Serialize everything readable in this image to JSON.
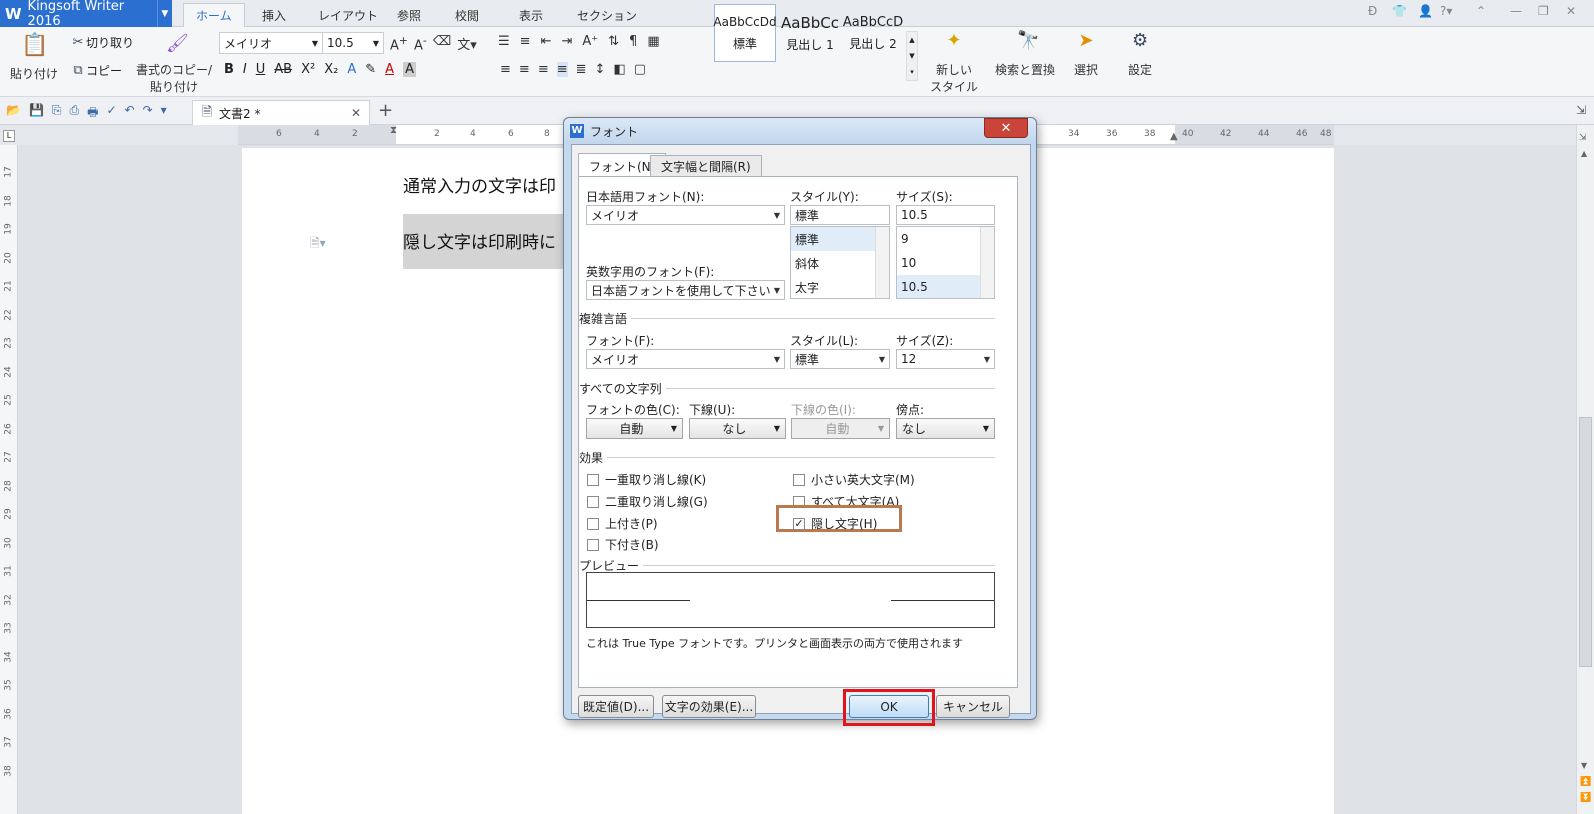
{
  "app": {
    "title": "Kingsoft Writer 2016"
  },
  "ribbon_tabs": [
    "ホーム",
    "挿入",
    "レイアウト",
    "参照",
    "校閲",
    "表示",
    "セクション"
  ],
  "ribbon": {
    "paste": "貼り付け",
    "cut": "切り取り",
    "copy": "コピー",
    "format_painter_1": "書式のコピー/",
    "format_painter_2": "貼り付け",
    "font_name": "メイリオ",
    "font_size": "10.5",
    "styles": [
      {
        "preview": "AaBbCcDd",
        "label": "標準"
      },
      {
        "preview": "AaBbCc",
        "label": "見出し 1"
      },
      {
        "preview": "AaBbCcD",
        "label": "見出し 2"
      }
    ],
    "new_style_1": "新しい",
    "new_style_2": "スタイル",
    "find_replace": "検索と置換",
    "select": "選択",
    "settings": "設定"
  },
  "doc_tab": {
    "name": "文書2 *"
  },
  "ruler": {
    "h_ticks": [
      "6",
      "4",
      "2",
      "2",
      "4",
      "6",
      "8",
      "34",
      "36",
      "38",
      "40",
      "42",
      "44",
      "46",
      "48"
    ],
    "v_ticks": [
      "17",
      "18",
      "19",
      "20",
      "21",
      "22",
      "23",
      "24",
      "25",
      "26",
      "27",
      "28",
      "29",
      "30",
      "31",
      "32",
      "33",
      "34",
      "35",
      "36",
      "37",
      "38"
    ]
  },
  "document": {
    "line1": "通常入力の文字は印",
    "line2": "隠し文字は印刷時に"
  },
  "dialog": {
    "title": "フォント",
    "tabs": [
      "フォント(N)",
      "文字幅と間隔(R)"
    ],
    "jp_font_label": "日本語用フォント(N):",
    "jp_font_value": "メイリオ",
    "style_label": "スタイル(Y):",
    "style_value": "標準",
    "style_list": [
      "標準",
      "斜体",
      "太字"
    ],
    "size_label": "サイズ(S):",
    "size_value": "10.5",
    "size_list": [
      "9",
      "10",
      "10.5"
    ],
    "en_font_label": "英数字用のフォント(F):",
    "en_font_value": "日本語フォントを使用して下さい",
    "complex_header": "複雑言語",
    "complex_font_label": "フォント(F):",
    "complex_font_value": "メイリオ",
    "complex_style_label": "スタイル(L):",
    "complex_style_value": "標準",
    "complex_size_label": "サイズ(Z):",
    "complex_size_value": "12",
    "all_chars_header": "すべての文字列",
    "font_color_label": "フォントの色(C):",
    "font_color_value": "自動",
    "underline_label": "下線(U):",
    "underline_value": "なし",
    "underline_color_label": "下線の色(I):",
    "underline_color_value": "自動",
    "emphasis_label": "傍点:",
    "emphasis_value": "なし",
    "effects_header": "効果",
    "effects": [
      {
        "label": "一重取り消し線(K)",
        "checked": false
      },
      {
        "label": "二重取り消し線(G)",
        "checked": false
      },
      {
        "label": "上付き(P)",
        "checked": false
      },
      {
        "label": "下付き(B)",
        "checked": false
      },
      {
        "label": "小さい英大文字(M)",
        "checked": false
      },
      {
        "label": "すべて大文字(A)",
        "checked": false
      },
      {
        "label": "隠し文字(H)",
        "checked": true
      }
    ],
    "preview_header": "プレビュー",
    "preview_note": "これは True Type フォントです。プリンタと画面表示の両方で使用されます",
    "default_button": "既定値(D)...",
    "text_effect_button": "文字の効果(E)...",
    "ok_button": "OK",
    "cancel_button": "キャンセル"
  },
  "colors": {
    "accent": "#2b6fd1",
    "highlight_ok": "#e0141e",
    "highlight_hidden": "#b97a4e"
  }
}
